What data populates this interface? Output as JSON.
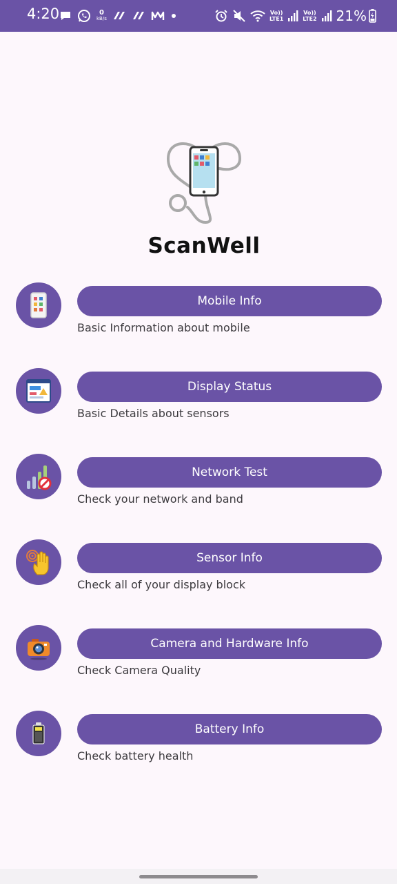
{
  "status_bar": {
    "time": "4:20",
    "net_speed_value": "0",
    "net_speed_unit": "kB/s",
    "volte_label": "Vo))",
    "lte1_label": "LTE1",
    "lte2_label": "LTE2",
    "battery_percent": "21%"
  },
  "app": {
    "title": "ScanWell"
  },
  "features": [
    {
      "label": "Mobile Info",
      "description": "Basic Information about mobile",
      "icon": "phone-apps-icon"
    },
    {
      "label": "Display Status",
      "description": "Basic Details about sensors",
      "icon": "display-window-icon"
    },
    {
      "label": "Network Test",
      "description": "Check your network and band",
      "icon": "signal-bars-icon"
    },
    {
      "label": "Sensor Info",
      "description": "Check all of your display block",
      "icon": "hand-sensor-icon"
    },
    {
      "label": "Camera and Hardware Info",
      "description": "Check Camera Quality",
      "icon": "camera-icon"
    },
    {
      "label": "Battery Info",
      "description": "Check battery health",
      "icon": "battery-icon"
    }
  ],
  "colors": {
    "primary": "#6a53a6",
    "background": "#fdf7fc",
    "text": "#3c3a3e"
  }
}
